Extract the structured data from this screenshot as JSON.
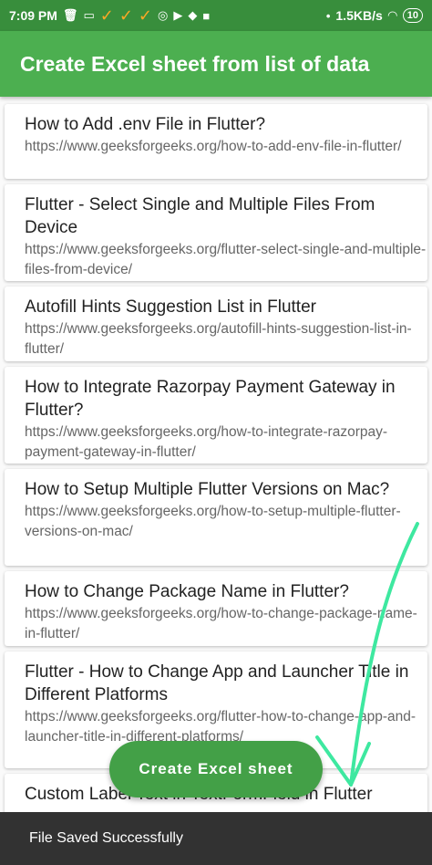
{
  "status_bar": {
    "time": "7:09 PM",
    "network_speed": "1.5KB/s",
    "battery": "10",
    "icons": [
      "trash-icon",
      "hd-icon",
      "check-icon",
      "check-icon",
      "check-icon",
      "instagram-icon",
      "youtube-icon",
      "app-icon",
      "app-icon",
      "signal-icon",
      "wifi-icon",
      "battery-icon"
    ]
  },
  "app_bar": {
    "title": "Create Excel sheet from list of data"
  },
  "items": [
    {
      "title": "How to Add .env File in Flutter?",
      "url": "https://www.geeksforgeeks.org/how-to-add-env-file-in-flutter/"
    },
    {
      "title": "Flutter - Select Single and Multiple Files From Device",
      "url": "https://www.geeksforgeeks.org/flutter-select-single-and-multiple-files-from-device/"
    },
    {
      "title": "Autofill Hints Suggestion List in Flutter",
      "url": "https://www.geeksforgeeks.org/autofill-hints-suggestion-list-in-flutter/"
    },
    {
      "title": "How to Integrate Razorpay Payment Gateway in Flutter?",
      "url": "https://www.geeksforgeeks.org/how-to-integrate-razorpay-payment-gateway-in-flutter/"
    },
    {
      "title": "How to Setup Multiple Flutter Versions on Mac?",
      "url": "https://www.geeksforgeeks.org/how-to-setup-multiple-flutter-versions-on-mac/"
    },
    {
      "title": "How to Change Package Name in Flutter?",
      "url": "https://www.geeksforgeeks.org/how-to-change-package-name-in-flutter/"
    },
    {
      "title": "Flutter - How to Change App and Launcher Title in Different Platforms",
      "url": "https://www.geeksforgeeks.org/flutter-how-to-change-app-and-launcher-title-in-different-platforms/"
    },
    {
      "title": "Custom Label Text in TextFormField in Flutter",
      "url": ""
    }
  ],
  "fab_label": "Create Excel sheet",
  "snackbar": {
    "message": "File Saved Successfully"
  },
  "colors": {
    "app_bar": "#4caf50",
    "status_bar": "#388e3c",
    "fab": "#43a047",
    "snackbar": "#323232",
    "annotation": "#3ee8a0"
  }
}
